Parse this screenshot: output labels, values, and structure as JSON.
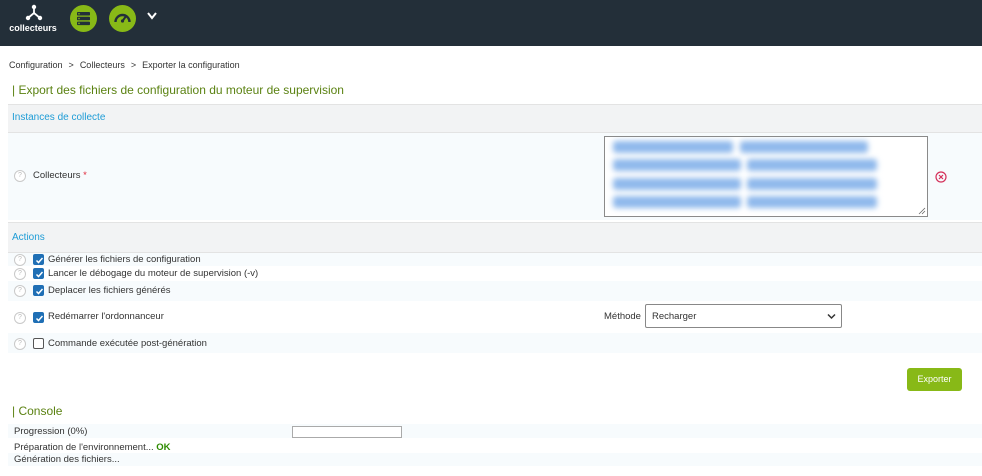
{
  "topbar": {
    "collectors_label": "collecteurs"
  },
  "breadcrumb": [
    "Configuration",
    "Collecteurs",
    "Exporter la configuration"
  ],
  "page_title": "| Export des fichiers de configuration du moteur de supervision",
  "instances": {
    "header": "Instances de collecte",
    "collectors_label": "Collecteurs",
    "required_mark": "*"
  },
  "actions": {
    "header": "Actions",
    "items": [
      {
        "label": "Générer les fichiers de configuration",
        "checked": true
      },
      {
        "label": "Lancer le débogage du moteur de supervision (-v)",
        "checked": true
      },
      {
        "label": "Deplacer les fichiers générés",
        "checked": true
      },
      {
        "label": "Redémarrer l'ordonnanceur",
        "checked": true
      },
      {
        "label": "Commande exécutée post-génération",
        "checked": false
      }
    ],
    "method_label": "Méthode",
    "method_value": "Recharger"
  },
  "export_button": "Exporter",
  "console": {
    "title": "| Console",
    "progress_label": "Progression (0%)",
    "progress": 0,
    "step1": "Préparation de l'environnement...",
    "step1_status": "OK",
    "step2": "Génération des fichiers..."
  },
  "colors": {
    "topbar": "#232f39",
    "accent_green": "#88b917",
    "title_green": "#5b8212",
    "link_blue": "#1e9cd6"
  }
}
